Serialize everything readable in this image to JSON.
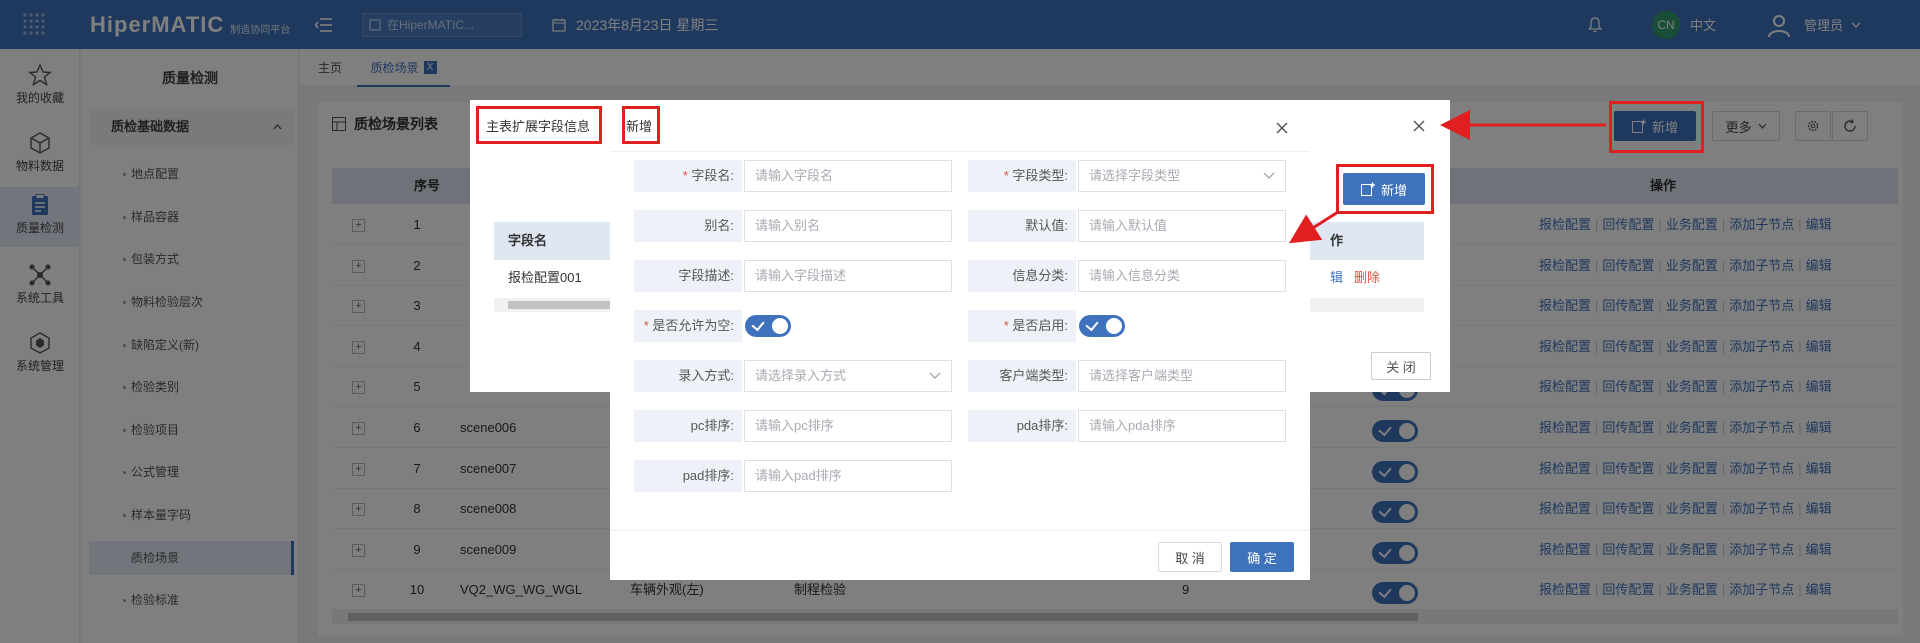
{
  "topbar": {
    "logo_text": "HiperMATIC",
    "logo_sub": "制造协同平台",
    "search_placeholder": "在HiperMATIC...",
    "date": "2023年8月23日 星期三",
    "lang_badge": "CN",
    "lang_label": "中文",
    "user": "管理员"
  },
  "rail": [
    {
      "label": "我的收藏",
      "icon": "star-icon"
    },
    {
      "label": "物料数据",
      "icon": "cube-icon"
    },
    {
      "label": "质量检测",
      "icon": "clipboard-icon"
    },
    {
      "label": "系统工具",
      "icon": "network-icon"
    },
    {
      "label": "系统管理",
      "icon": "box-icon"
    }
  ],
  "sidenav": {
    "title": "质量检测",
    "group": "质检基础数据",
    "items": [
      "地点配置",
      "样品容器",
      "包装方式",
      "物料检验层次",
      "缺陷定义(新)",
      "检验类别",
      "检验项目",
      "公式管理",
      "样本量字码",
      "质检场景",
      "检验标准"
    ],
    "active_index": 9
  },
  "tabs": [
    {
      "label": "主页"
    },
    {
      "label": "质检场景",
      "close": "X"
    }
  ],
  "panel": {
    "title": "质检场景列表",
    "add_label": "新增",
    "more_label": "更多",
    "col_seq": "序号",
    "col_ops": "操作",
    "ops": [
      "报检配置",
      "回传配置",
      "业务配置",
      "添加子节点",
      "编辑"
    ],
    "rows": [
      {
        "seq": "1",
        "code": "",
        "name": "",
        "type": "",
        "num": ""
      },
      {
        "seq": "2",
        "code": "",
        "name": "",
        "type": "",
        "num": ""
      },
      {
        "seq": "3",
        "code": "",
        "name": "",
        "type": "",
        "num": ""
      },
      {
        "seq": "4",
        "code": "",
        "name": "",
        "type": "",
        "num": ""
      },
      {
        "seq": "5",
        "code": "",
        "name": "",
        "type": "",
        "num": ""
      },
      {
        "seq": "6",
        "code": "scene006",
        "name": "",
        "type": "",
        "num": ""
      },
      {
        "seq": "7",
        "code": "scene007",
        "name": "",
        "type": "",
        "num": ""
      },
      {
        "seq": "8",
        "code": "scene008",
        "name": "",
        "type": "",
        "num": ""
      },
      {
        "seq": "9",
        "code": "scene009",
        "name": "",
        "type": "",
        "num": ""
      },
      {
        "seq": "10",
        "code": "VQ2_WG_WG_WGL",
        "name": "车辆外观(左)",
        "type": "制程检验",
        "num": "9"
      }
    ]
  },
  "mid_dialog": {
    "title": "主表扩展字段信息",
    "add_label": "新增",
    "col_field": "字段名",
    "col_ops": "作",
    "row_field": "报检配置001",
    "row_edit": "辑",
    "row_delete": "删除",
    "close_label": "关 闭"
  },
  "front_dialog": {
    "title": "新增",
    "fields": [
      {
        "label": "字段名:",
        "required": true,
        "placeholder": "请输入字段名",
        "kind": "input"
      },
      {
        "label": "字段类型:",
        "required": true,
        "placeholder": "请选择字段类型",
        "kind": "select"
      },
      {
        "label": "别名:",
        "required": false,
        "placeholder": "请输入别名",
        "kind": "input"
      },
      {
        "label": "默认值:",
        "required": false,
        "placeholder": "请输入默认值",
        "kind": "input"
      },
      {
        "label": "字段描述:",
        "required": false,
        "placeholder": "请输入字段描述",
        "kind": "input"
      },
      {
        "label": "信息分类:",
        "required": false,
        "placeholder": "请输入信息分类",
        "kind": "input"
      },
      {
        "label": "是否允许为空:",
        "required": true,
        "kind": "switch",
        "on": true
      },
      {
        "label": "是否启用:",
        "required": true,
        "kind": "switch",
        "on": true
      },
      {
        "label": "录入方式:",
        "required": false,
        "placeholder": "请选择录入方式",
        "kind": "select"
      },
      {
        "label": "客户端类型:",
        "required": false,
        "placeholder": "请选择客户端类型",
        "kind": "input"
      },
      {
        "label": "pc排序:",
        "required": false,
        "placeholder": "请输入pc排序",
        "kind": "input"
      },
      {
        "label": "pda排序:",
        "required": false,
        "placeholder": "请输入pda排序",
        "kind": "input"
      },
      {
        "label": "pad排序:",
        "required": false,
        "placeholder": "请输入pad排序",
        "kind": "input"
      }
    ],
    "cancel_label": "取 消",
    "ok_label": "确 定"
  },
  "colors": {
    "primary": "#3f72bd",
    "annotation": "#e02020"
  }
}
